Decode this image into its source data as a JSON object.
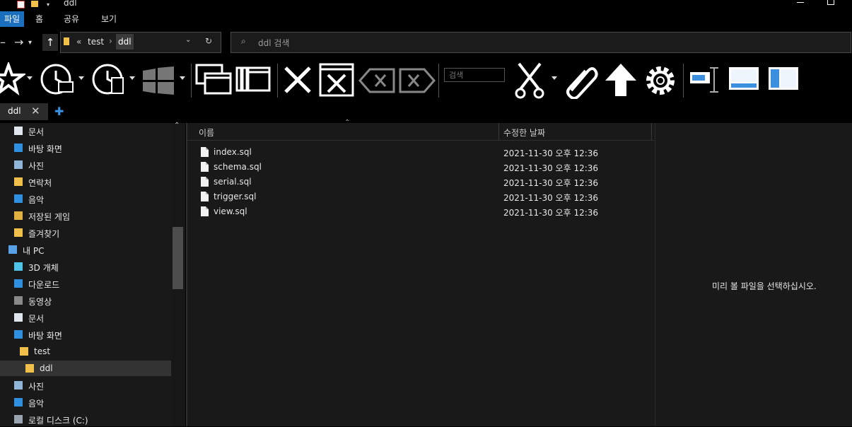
{
  "window": {
    "title": "ddl"
  },
  "menu": {
    "file": "파일",
    "home": "홈",
    "share": "공유",
    "view": "보기"
  },
  "address": {
    "crumb_prefix": "«",
    "crumb_parent": "test",
    "crumb_current": "ddl"
  },
  "search": {
    "placeholder": "ddl 검색"
  },
  "toolbar": {
    "search_placeholder": "검색"
  },
  "tab": {
    "label": "ddl"
  },
  "navigation": {
    "items": [
      {
        "label": "문서",
        "icon": "document-icon"
      },
      {
        "label": "바탕 화면",
        "icon": "desktop-icon"
      },
      {
        "label": "사진",
        "icon": "pictures-icon"
      },
      {
        "label": "연락처",
        "icon": "contacts-icon"
      },
      {
        "label": "음악",
        "icon": "music-icon"
      },
      {
        "label": "저장된 게임",
        "icon": "saved-games-icon"
      },
      {
        "label": "즐겨찾기",
        "icon": "favorites-icon"
      },
      {
        "label": "내 PC",
        "icon": "pc-icon"
      },
      {
        "label": "3D 개체",
        "icon": "3d-objects-icon"
      },
      {
        "label": "다운로드",
        "icon": "download-icon"
      },
      {
        "label": "동영상",
        "icon": "videos-icon"
      },
      {
        "label": "문서",
        "icon": "document-icon"
      },
      {
        "label": "바탕 화면",
        "icon": "desktop-icon"
      },
      {
        "label": "test",
        "icon": "folder-icon"
      },
      {
        "label": "ddl",
        "icon": "folder-icon"
      },
      {
        "label": "사진",
        "icon": "pictures-icon"
      },
      {
        "label": "음악",
        "icon": "music-icon"
      },
      {
        "label": "로컬 디스크 (C:)",
        "icon": "drive-icon"
      }
    ]
  },
  "columns": {
    "name": "이름",
    "modified": "수정한 날짜"
  },
  "files": [
    {
      "name": "index.sql",
      "modified": "2021-11-30 오후 12:36"
    },
    {
      "name": "schema.sql",
      "modified": "2021-11-30 오후 12:36"
    },
    {
      "name": "serial.sql",
      "modified": "2021-11-30 오후 12:36"
    },
    {
      "name": "trigger.sql",
      "modified": "2021-11-30 오후 12:36"
    },
    {
      "name": "view.sql",
      "modified": "2021-11-30 오후 12:36"
    }
  ],
  "preview": {
    "message": "미리 볼 파일을 선택하십시오."
  },
  "colors": {
    "accent": "#1a6fbf",
    "background": "#191919",
    "folder": "#f0c04a"
  }
}
